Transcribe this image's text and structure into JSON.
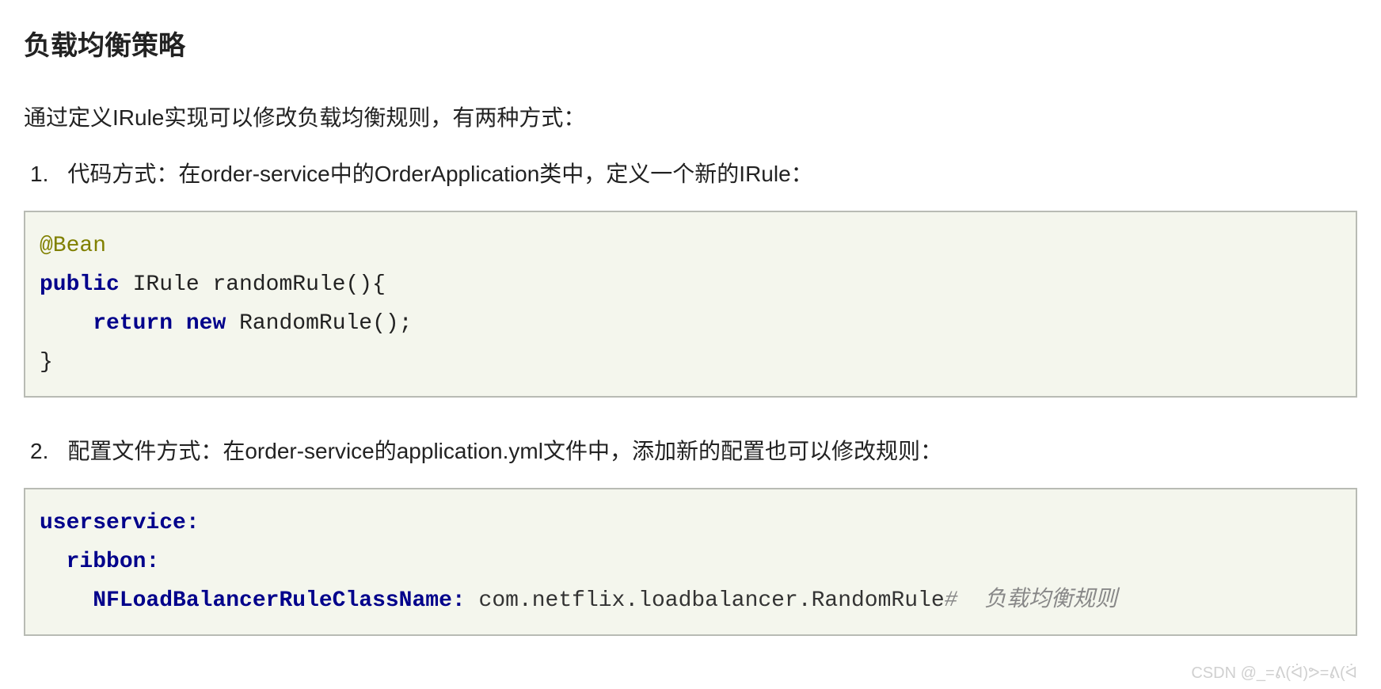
{
  "heading": "负载均衡策略",
  "intro": "通过定义IRule实现可以修改负载均衡规则，有两种方式：",
  "item1": {
    "num": "1.",
    "text": "代码方式：在order-service中的OrderApplication类中，定义一个新的IRule："
  },
  "code1": {
    "l1_annotation": "@Bean",
    "l2_kw1": "public",
    "l2_type": " IRule randomRule(){",
    "l3_indent": "    ",
    "l3_kw1": "return",
    "l3_kw2": " new",
    "l3_rest": " RandomRule();",
    "l4": "}"
  },
  "item2": {
    "num": "2.",
    "text": "配置文件方式：在order-service的application.yml文件中，添加新的配置也可以修改规则："
  },
  "code2": {
    "l1_key": "userservice",
    "l1_colon": ":",
    "l2_indent": "  ",
    "l2_key": "ribbon",
    "l2_colon": ":",
    "l3_indent": "    ",
    "l3_key": "NFLoadBalancerRuleClassName",
    "l3_colon": ":",
    "l3_value": " com.netflix.loadbalancer.RandomRule",
    "l3_comment": "#  负载均衡规则"
  },
  "watermark": "CSDN @_=ᕕ(ᐛ)ᕗ=ᕕ(ᐛ"
}
